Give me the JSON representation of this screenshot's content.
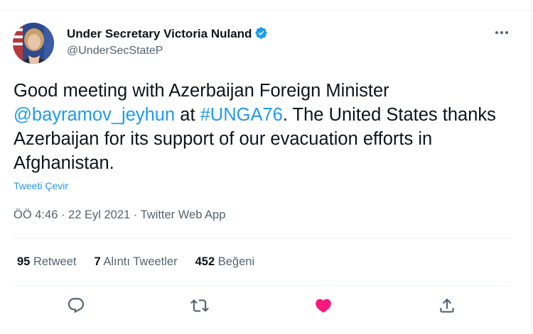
{
  "author": {
    "display_name": "Under Secretary Victoria Nuland",
    "handle": "@UnderSecStateP"
  },
  "tweet": {
    "text_part1": "Good meeting with Azerbaijan Foreign Minister ",
    "mention": "@bayramov_jeyhun",
    "text_part2": " at ",
    "hashtag": "#UNGA76",
    "text_part3": ". The United States thanks Azerbaijan for its support of our evacuation efforts in Afghanistan.",
    "translate_label": "Tweeti Çevir",
    "time": "ÖÖ 4:46",
    "separator1": " · ",
    "date": "22 Eyl 2021",
    "separator2": " · ",
    "source": "Twitter Web App"
  },
  "stats": {
    "retweets_count": "95",
    "retweets_label": "Retweet",
    "quotes_count": "7",
    "quotes_label": "Alıntı Tweetler",
    "likes_count": "452",
    "likes_label": "Beğeni"
  },
  "colors": {
    "accent": "#1d9bf0",
    "like": "#f91880",
    "muted": "#536471",
    "divider": "#eff3f4"
  },
  "icons": {
    "verified": "verified-badge-icon",
    "more": "more-icon",
    "reply": "reply-icon",
    "retweet": "retweet-icon",
    "like": "heart-icon",
    "share": "share-icon"
  }
}
